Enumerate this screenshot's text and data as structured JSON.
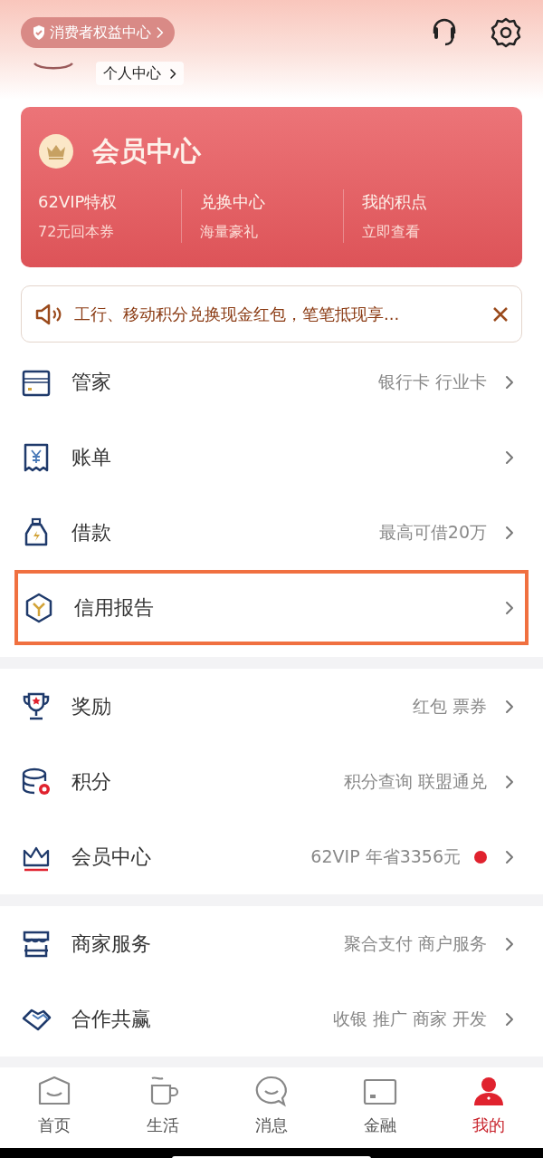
{
  "header": {
    "rights_badge": "消费者权益中心",
    "personal_link": "个人中心"
  },
  "member_card": {
    "title": "会员中心",
    "items": [
      {
        "title": "62VIP特权",
        "subtitle": "72元回本券"
      },
      {
        "title": "兑换中心",
        "subtitle": "海量豪礼"
      },
      {
        "title": "我的积点",
        "subtitle": "立即查看"
      }
    ]
  },
  "notice": {
    "text": "工行、移动积分兑换现金红包，笔笔抵现享..."
  },
  "sections": [
    [
      {
        "kind": "card",
        "label": "管家",
        "detail": "银行卡 行业卡",
        "dot": false,
        "highlighted": false
      },
      {
        "kind": "bill",
        "label": "账单",
        "dot": false,
        "highlighted": false
      },
      {
        "kind": "loan",
        "label": "借款",
        "detail": "最高可借20万",
        "dot": false,
        "highlighted": false
      },
      {
        "kind": "credit",
        "label": "信用报告",
        "dot": false,
        "highlighted": true
      }
    ],
    [
      {
        "kind": "trophy",
        "label": "奖励",
        "detail": "红包 票券",
        "dot": false,
        "highlighted": false
      },
      {
        "kind": "points",
        "label": "积分",
        "detail": "积分查询 联盟通兑",
        "dot": false,
        "highlighted": false
      },
      {
        "kind": "crown",
        "label": "会员中心",
        "detail": "62VIP 年省3356元",
        "dot": true,
        "highlighted": false
      }
    ],
    [
      {
        "kind": "shop",
        "label": "商家服务",
        "detail": "聚合支付 商户服务",
        "dot": false,
        "highlighted": false
      },
      {
        "kind": "handshake",
        "label": "合作共赢",
        "detail": "收银 推广 商家 开发",
        "dot": false,
        "highlighted": false
      }
    ]
  ],
  "tabs": [
    {
      "label": "首页",
      "selected": false
    },
    {
      "label": "生活",
      "selected": false
    },
    {
      "label": "消息",
      "selected": false
    },
    {
      "label": "金融",
      "selected": false
    },
    {
      "label": "我的",
      "selected": true
    }
  ]
}
